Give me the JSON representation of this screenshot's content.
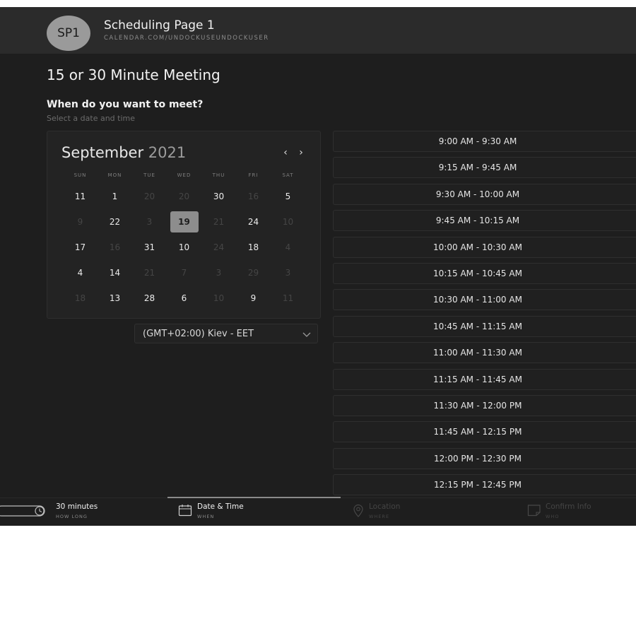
{
  "header": {
    "avatar_initials": "SP1",
    "page_name": "Scheduling Page 1",
    "page_url": "CALENDAR.COM/UNDOCKUSEUNDOCKUSER"
  },
  "meeting": {
    "title": "15 or 30 Minute Meeting",
    "prompt": "When do you want to meet?",
    "prompt_sub": "Select a date and time"
  },
  "calendar": {
    "month": "September",
    "year": "2021",
    "prev_label": "‹",
    "next_label": "›",
    "weekdays": [
      "SUN",
      "MON",
      "TUE",
      "WED",
      "THU",
      "FRI",
      "SAT"
    ],
    "weeks": [
      [
        {
          "d": "11",
          "s": "a"
        },
        {
          "d": "1",
          "s": "a"
        },
        {
          "d": "20",
          "s": "x"
        },
        {
          "d": "20",
          "s": "x"
        },
        {
          "d": "30",
          "s": "a"
        },
        {
          "d": "16",
          "s": "x"
        },
        {
          "d": "5",
          "s": "a"
        }
      ],
      [
        {
          "d": "9",
          "s": "x"
        },
        {
          "d": "22",
          "s": "a"
        },
        {
          "d": "3",
          "s": "x"
        },
        {
          "d": "19",
          "s": "sel"
        },
        {
          "d": "21",
          "s": "x"
        },
        {
          "d": "24",
          "s": "a"
        },
        {
          "d": "10",
          "s": "x"
        }
      ],
      [
        {
          "d": "17",
          "s": "a"
        },
        {
          "d": "16",
          "s": "x"
        },
        {
          "d": "31",
          "s": "a"
        },
        {
          "d": "10",
          "s": "a"
        },
        {
          "d": "24",
          "s": "x"
        },
        {
          "d": "18",
          "s": "a"
        },
        {
          "d": "4",
          "s": "x"
        }
      ],
      [
        {
          "d": "4",
          "s": "a"
        },
        {
          "d": "14",
          "s": "a"
        },
        {
          "d": "21",
          "s": "x"
        },
        {
          "d": "7",
          "s": "x"
        },
        {
          "d": "3",
          "s": "x"
        },
        {
          "d": "29",
          "s": "x"
        },
        {
          "d": "3",
          "s": "x"
        }
      ],
      [
        {
          "d": "18",
          "s": "x"
        },
        {
          "d": "13",
          "s": "a"
        },
        {
          "d": "28",
          "s": "a"
        },
        {
          "d": "6",
          "s": "a"
        },
        {
          "d": "10",
          "s": "x"
        },
        {
          "d": "9",
          "s": "a"
        },
        {
          "d": "11",
          "s": "x"
        }
      ]
    ]
  },
  "timezone": {
    "selected": "(GMT+02:00) Kiev - EET"
  },
  "time_slots": [
    "9:00 AM - 9:30 AM",
    "9:15 AM - 9:45 AM",
    "9:30 AM - 10:00 AM",
    "9:45 AM - 10:15 AM",
    "10:00 AM - 10:30 AM",
    "10:15 AM - 10:45 AM",
    "10:30 AM - 11:00 AM",
    "10:45 AM - 11:15 AM",
    "11:00 AM - 11:30 AM",
    "11:15 AM - 11:45 AM",
    "11:30 AM - 12:00 PM",
    "11:45 AM - 12:15 PM",
    "12:00 PM - 12:30 PM",
    "12:15 PM - 12:45 PM"
  ],
  "steps": [
    {
      "label": "30 minutes",
      "sub": "HOW LONG",
      "icon": "clock-icon",
      "state": "active"
    },
    {
      "label": "Date & Time",
      "sub": "WHEN",
      "icon": "calendar-icon",
      "state": "active"
    },
    {
      "label": "Location",
      "sub": "WHERE",
      "icon": "location-pin-icon",
      "state": "disabled"
    },
    {
      "label": "Confirm Info",
      "sub": "WHO",
      "icon": "confirm-info-icon",
      "state": "disabled"
    }
  ],
  "colors": {
    "background": "#1e1e1e",
    "header_bg": "#2b2b2b",
    "selected_day": "#8d8d8d",
    "avatar": "#9a9a9a"
  }
}
